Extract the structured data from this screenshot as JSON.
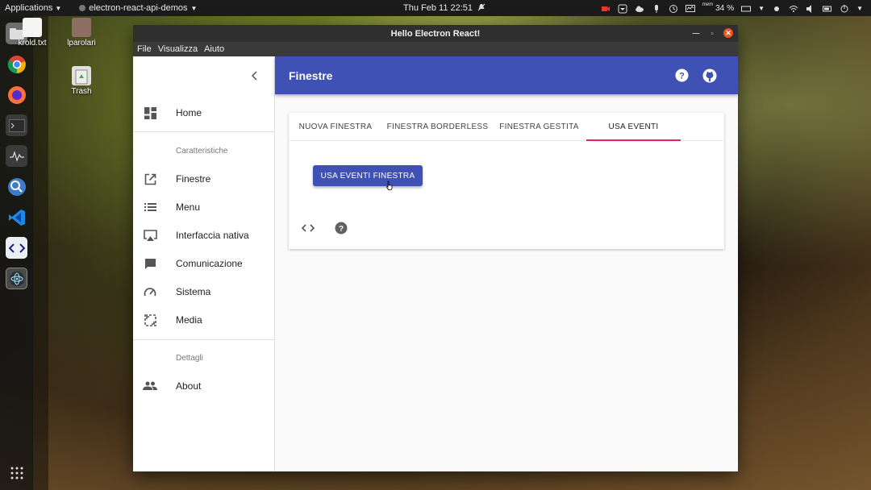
{
  "topbar": {
    "applications_label": "Applications",
    "app_name": "electron-react-api-demos",
    "clock": "Thu Feb 11  22:51",
    "mem_label": "mem",
    "mem_percent": "34",
    "mem_unit": "%"
  },
  "desktop": {
    "icons": [
      {
        "label": "krold.txt"
      },
      {
        "label": "lparolari"
      },
      {
        "label": "Trash"
      }
    ]
  },
  "window": {
    "title": "Hello Electron React!",
    "menu": [
      "File",
      "Visualizza",
      "Aiuto"
    ]
  },
  "sidebar": {
    "items": [
      {
        "label": "Home",
        "icon": "dashboard-icon"
      },
      {
        "label": "Finestre",
        "icon": "open-in-new-icon"
      },
      {
        "label": "Menu",
        "icon": "list-icon"
      },
      {
        "label": "Interfaccia nativa",
        "icon": "airplay-icon"
      },
      {
        "label": "Comunicazione",
        "icon": "chat-icon"
      },
      {
        "label": "Sistema",
        "icon": "speed-icon"
      },
      {
        "label": "Media",
        "icon": "screenshot-icon"
      },
      {
        "label": "About",
        "icon": "people-icon"
      }
    ],
    "sections": [
      "Caratteristiche",
      "Dettagli"
    ]
  },
  "appbar": {
    "title": "Finestre"
  },
  "tabs": [
    {
      "label": "NUOVA FINESTRA"
    },
    {
      "label": "FINESTRA BORDERLESS"
    },
    {
      "label": "FINESTRA GESTITA"
    },
    {
      "label": "USA EVENTI",
      "active": true
    }
  ],
  "panel": {
    "button_label": "USA EVENTI FINESTRA"
  },
  "colors": {
    "primary": "#3f51b5",
    "accent": "#e91e63",
    "ubuntu_close": "#e95420"
  }
}
